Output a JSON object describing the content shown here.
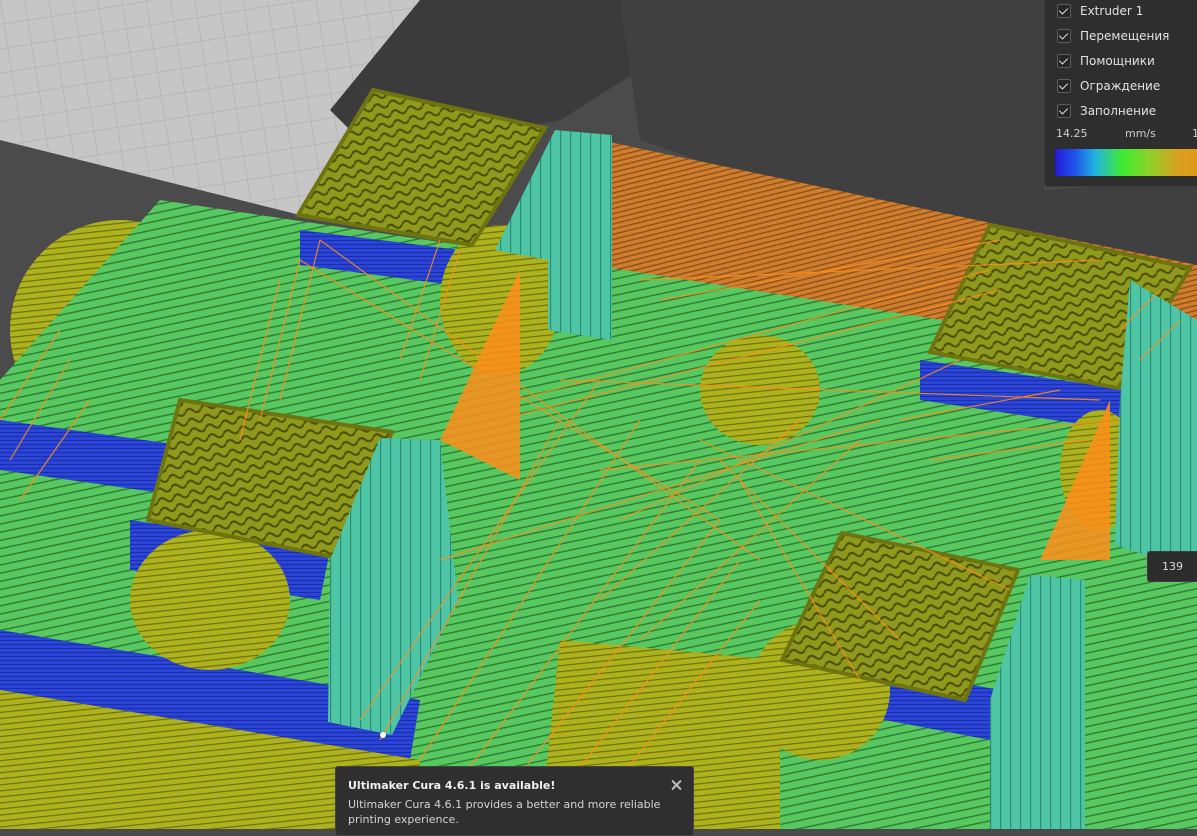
{
  "app": {
    "accent_color": "#ef8e18",
    "panel_background": "#2e2e2e"
  },
  "view_panel": {
    "features": [
      {
        "label": "Extruder 1",
        "checked": true
      },
      {
        "label": "Перемещения",
        "checked": true
      },
      {
        "label": "Помощники",
        "checked": true
      },
      {
        "label": "Ограждение",
        "checked": true
      },
      {
        "label": "Заполнение",
        "checked": true
      }
    ],
    "legend": {
      "min_label": "14.25",
      "unit_label": "mm/s",
      "max_label_partial": "1"
    }
  },
  "layer_slider": {
    "current_layer": "139"
  },
  "notification": {
    "title": "Ultimaker Cura 4.6.1 is available!",
    "body": "Ultimaker Cura 4.6.1 provides a better and more reliable printing experience.",
    "close_icon": "close-icon"
  }
}
